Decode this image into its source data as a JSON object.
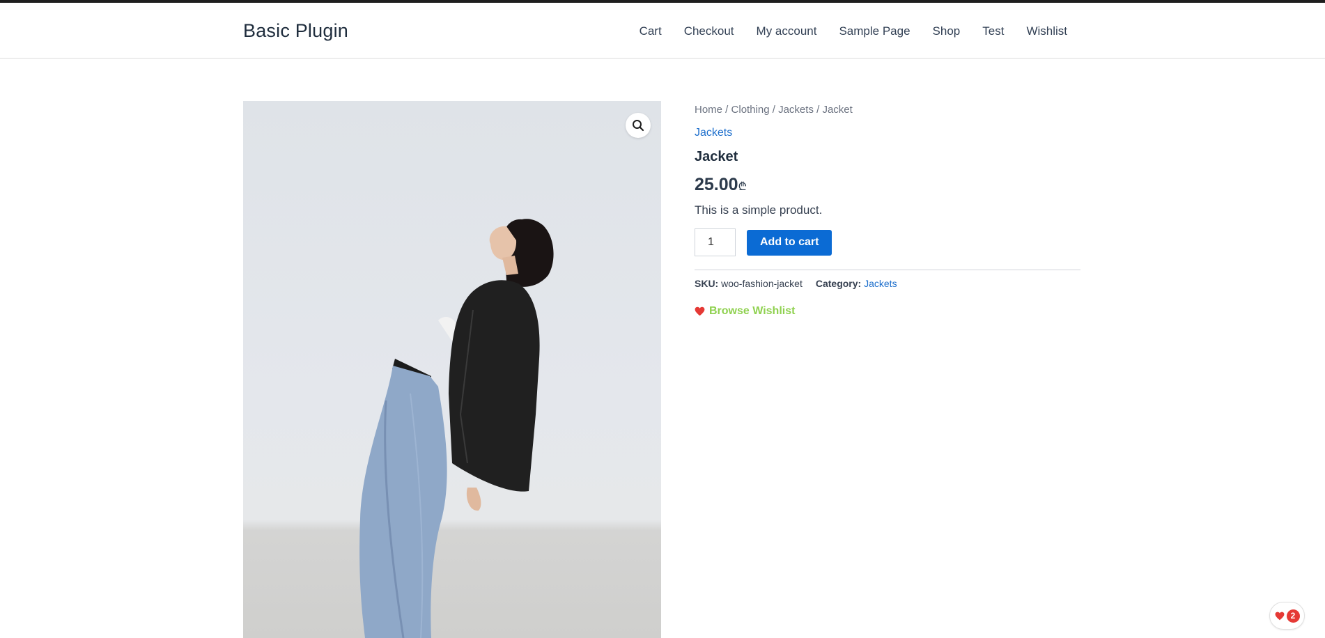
{
  "site": {
    "title": "Basic Plugin"
  },
  "nav": {
    "items": [
      {
        "label": "Cart"
      },
      {
        "label": "Checkout"
      },
      {
        "label": "My account"
      },
      {
        "label": "Sample Page"
      },
      {
        "label": "Shop"
      },
      {
        "label": "Test"
      },
      {
        "label": "Wishlist"
      }
    ]
  },
  "gallery": {
    "zoom_icon": "search-icon"
  },
  "breadcrumb": {
    "home": "Home",
    "sep": " / ",
    "clothing": "Clothing",
    "jackets": "Jackets",
    "current": "Jacket"
  },
  "product": {
    "category_link": "Jackets",
    "title": "Jacket",
    "price": "25.00",
    "currency": "₾",
    "short_description": "This is a simple product.",
    "quantity": "1",
    "add_to_cart_label": "Add to cart",
    "sku_label": "SKU:",
    "sku": "woo-fashion-jacket",
    "category_label": "Category:",
    "category": "Jackets"
  },
  "wishlist": {
    "browse_label": "Browse Wishlist",
    "count": "2",
    "icon": "heart-icon"
  },
  "colors": {
    "accent": "#0b6bd4",
    "link": "#1e6fcc",
    "wishlist_text": "#8fd14f",
    "heart": "#e53935"
  }
}
